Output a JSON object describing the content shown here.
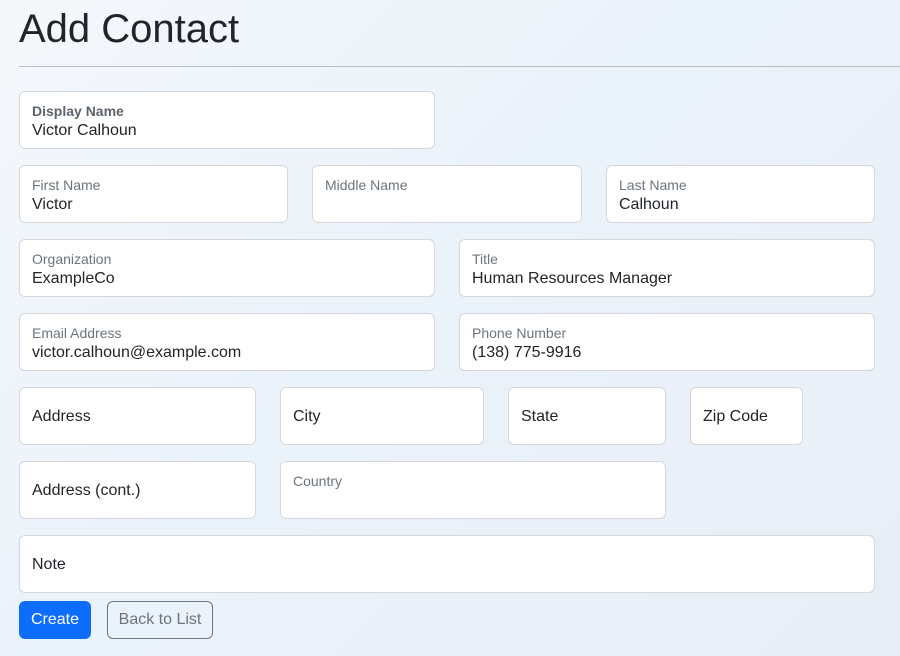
{
  "page": {
    "title": "Add Contact"
  },
  "form": {
    "display_name": {
      "label": "Display Name",
      "value": "Victor Calhoun"
    },
    "first_name": {
      "label": "First Name",
      "value": "Victor"
    },
    "middle_name": {
      "label": "Middle Name",
      "value": ""
    },
    "last_name": {
      "label": "Last Name",
      "value": "Calhoun"
    },
    "organization": {
      "label": "Organization",
      "value": "ExampleCo"
    },
    "title": {
      "label": "Title",
      "value": "Human Resources Manager"
    },
    "email": {
      "label": "Email Address",
      "value": "victor.calhoun@example.com"
    },
    "phone": {
      "label": "Phone Number",
      "value": "(138) 775-9916"
    },
    "address": {
      "placeholder": "Address"
    },
    "city": {
      "placeholder": "City"
    },
    "state": {
      "placeholder": "State"
    },
    "zip": {
      "placeholder": "Zip Code"
    },
    "address2": {
      "placeholder": "Address (cont.)"
    },
    "country": {
      "label": "Country",
      "value": ""
    },
    "note": {
      "placeholder": "Note"
    }
  },
  "actions": {
    "create_label": "Create",
    "back_label": "Back to List"
  },
  "colors": {
    "primary": "#0d6efd",
    "secondary": "#6c757d",
    "field_border": "#d4d8dd"
  }
}
